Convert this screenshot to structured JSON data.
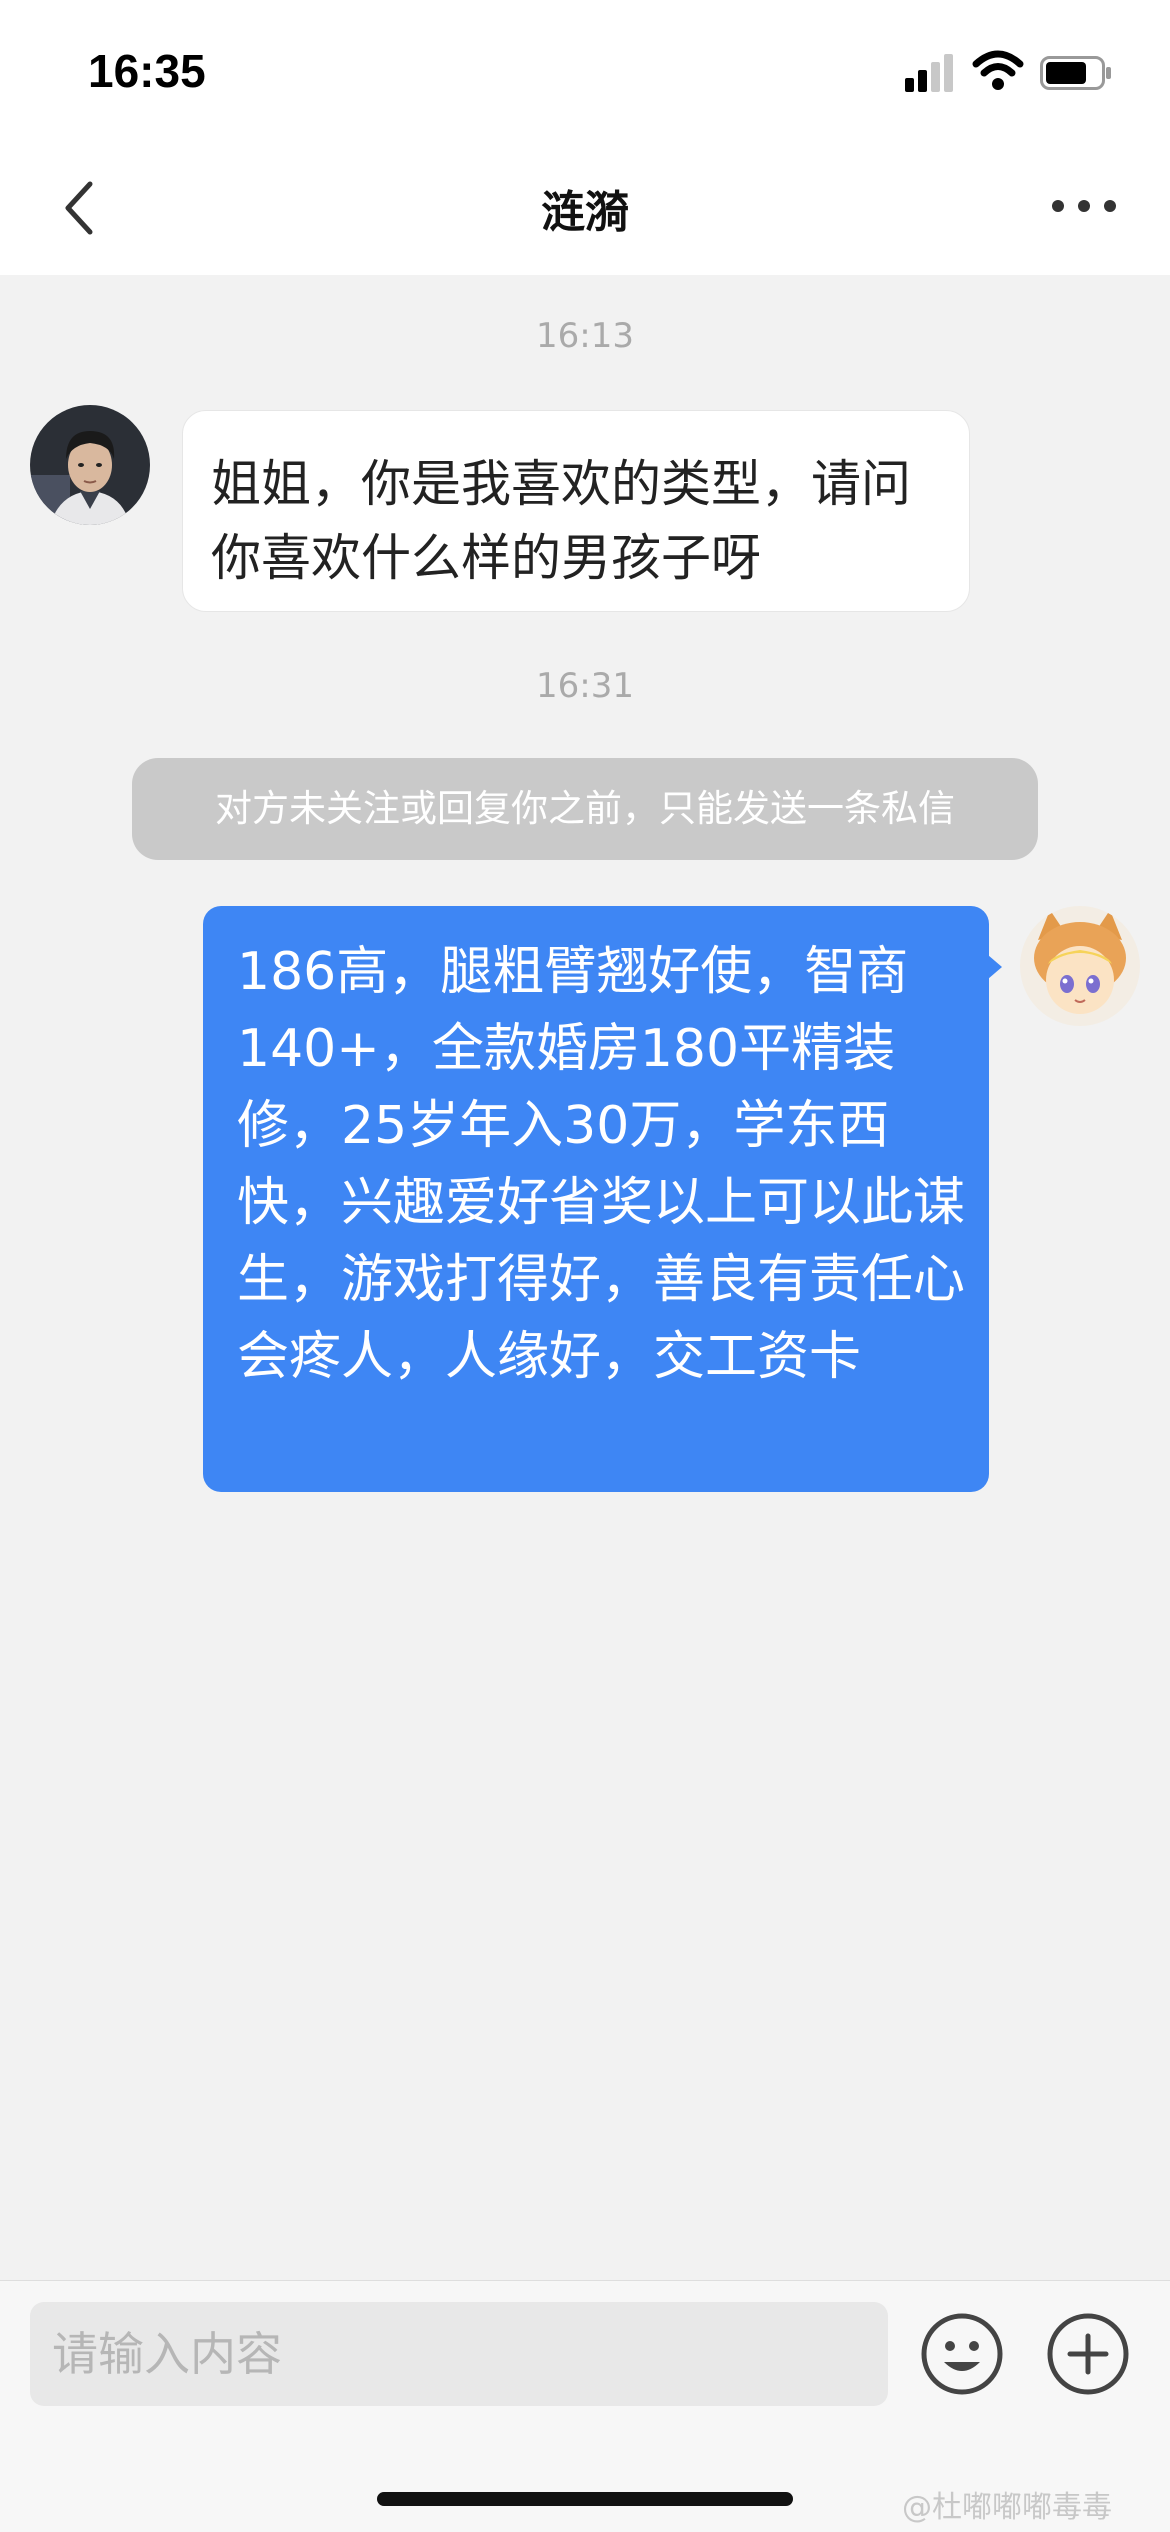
{
  "status_bar": {
    "time": "16:35",
    "signal_icon": "cellular-signal-icon",
    "wifi_icon": "wifi-icon",
    "battery_icon": "battery-icon"
  },
  "header": {
    "back_icon": "chevron-left-icon",
    "title": "涟漪",
    "more_icon": "more-dots-icon"
  },
  "conversation": {
    "timestamp_1": "16:13",
    "incoming_message": {
      "sender_avatar": "avatar-man-illustration",
      "text": "姐姐，你是我喜欢的类型，请问你喜欢什么样的男孩子呀"
    },
    "timestamp_2": "16:31",
    "system_notice": "对方未关注或回复你之前，只能发送一条私信",
    "outgoing_message": {
      "sender_avatar": "avatar-fox-hood-illustration",
      "text": "186高，腿粗臂翘好使，智商140+，全款婚房180平精装修，25岁年入30万，学东西快，兴趣爱好省奖以上可以此谋生，游戏打得好，善良有责任心会疼人，人缘好，交工资卡"
    }
  },
  "input_bar": {
    "placeholder": "请输入内容",
    "emoji_icon": "emoji-icon",
    "plus_icon": "plus-circle-icon"
  },
  "watermark": "@杜嘟嘟嘟毒毒",
  "colors": {
    "outgoing_bubble": "#3e86f4",
    "incoming_bubble": "#ffffff",
    "chat_background": "#f2f2f2",
    "notice_background": "#c9c9c9"
  }
}
